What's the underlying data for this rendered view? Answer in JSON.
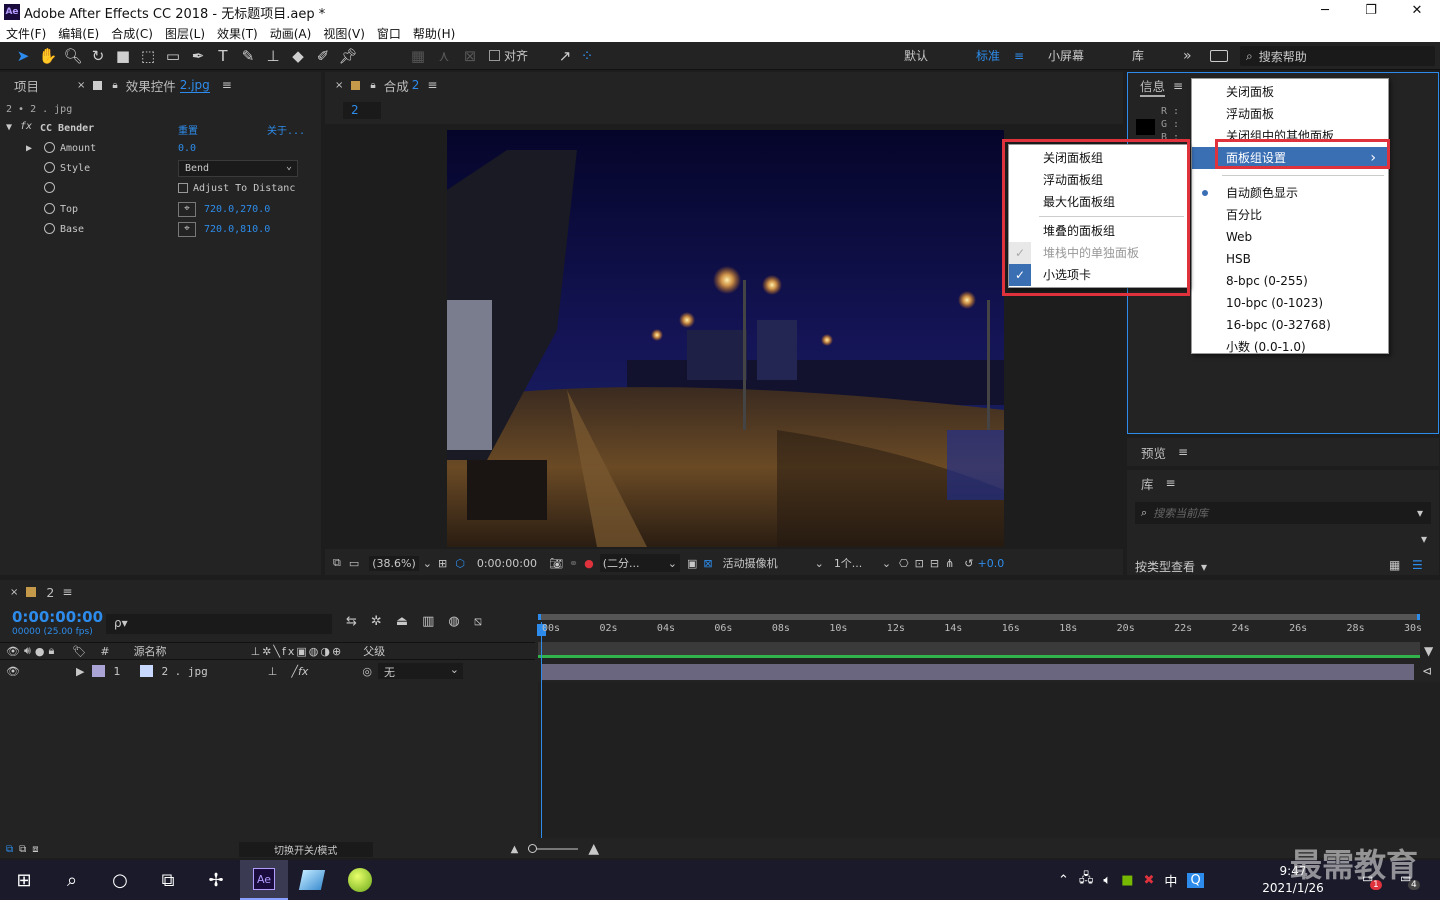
{
  "window": {
    "title": "Adobe After Effects CC 2018 - 无标题项目.aep *",
    "app_icon": "Ae",
    "min": "─",
    "max": "❐",
    "close": "✕"
  },
  "menubar": [
    "文件(F)",
    "编辑(E)",
    "合成(C)",
    "图层(L)",
    "效果(T)",
    "动画(A)",
    "视图(V)",
    "窗口",
    "帮助(H)"
  ],
  "toolbar": {
    "align_label": "对齐",
    "workspaces": [
      "默认",
      "标准",
      "小屏幕",
      "库"
    ],
    "more": "»",
    "search_placeholder": "搜索帮助"
  },
  "project_panel": {
    "tab_project": "项目",
    "tab_effects": "效果控件",
    "effects_target": "2.jpg",
    "layer_path": "2 • 2 . jpg",
    "effect": {
      "name": "CC Bender",
      "reset": "重置",
      "about": "关于...",
      "props": [
        {
          "name": "Amount",
          "value": "0.0"
        },
        {
          "name": "Style",
          "value": "Bend"
        },
        {
          "name": "",
          "value": "Adjust To Distanc"
        },
        {
          "name": "Top",
          "value": "720.0,270.0"
        },
        {
          "name": "Base",
          "value": "720.0,810.0"
        }
      ]
    }
  },
  "comp_panel": {
    "tab_label": "合成",
    "tab_name": "2",
    "subtab": "2",
    "zoom": "(38.6%)",
    "timecode": "0:00:00:00",
    "resolution": "(二分...",
    "camera": "活动摄像机",
    "views": "1个...",
    "exposure": "+0.0"
  },
  "info_panel": {
    "title": "信息",
    "rgb": [
      "R :",
      "G :",
      "B :"
    ]
  },
  "info_menu": {
    "items": [
      "关闭面板",
      "浮动面板",
      "关闭组中的其他面板",
      "面板组设置",
      "自动颜色显示",
      "百分比",
      "Web",
      "HSB",
      "8-bpc (0-255)",
      "10-bpc (0-1023)",
      "16-bpc (0-32768)",
      "小数 (0.0-1.0)"
    ],
    "submenu_arrow": "›",
    "radio_selected": "自动颜色显示"
  },
  "group_menu": {
    "items": [
      "关闭面板组",
      "浮动面板组",
      "最大化面板组",
      "堆叠的面板组",
      "堆栈中的单独面板",
      "小选项卡"
    ],
    "checked": [
      "堆栈中的单独面板",
      "小选项卡"
    ],
    "disabled": [
      "堆栈中的单独面板"
    ]
  },
  "preview_panel": {
    "title": "预览"
  },
  "library_panel": {
    "title": "库",
    "search_placeholder": "搜索当前库",
    "view_by": "按类型查看"
  },
  "timeline": {
    "tab": "2",
    "timecode": "0:00:00:00",
    "frames": "00000 (25.00 fps)",
    "search_icon": "ρ▾",
    "col_source": "源名称",
    "col_parent": "父级",
    "col_num": "#",
    "layer": {
      "num": "1",
      "name": "2 . jpg",
      "parent": "无"
    },
    "ruler": [
      "00s",
      "02s",
      "04s",
      "06s",
      "08s",
      "10s",
      "12s",
      "14s",
      "16s",
      "18s",
      "20s",
      "22s",
      "24s",
      "26s",
      "28s",
      "30s"
    ],
    "footer": "切换开关/模式"
  },
  "taskbar": {
    "time": "9:47",
    "date": "2021/1/26",
    "ime": "中",
    "watermark": "最需教育",
    "notif_badge": "1",
    "action_badge": "4"
  },
  "colors": {
    "accent_blue": "#2d8ceb",
    "highlight_red": "#e0323c",
    "menu_selected": "#3a6fb4",
    "green_bar": "#2fb34a"
  }
}
